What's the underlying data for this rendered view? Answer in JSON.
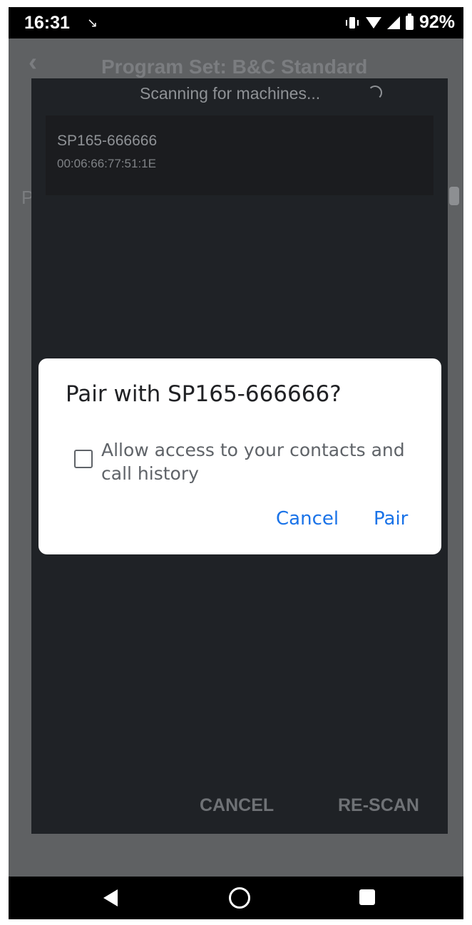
{
  "status_bar": {
    "time": "16:31",
    "notification_icon": "missed-call-icon",
    "battery_percent": "92%",
    "icons": [
      "vibrate-icon",
      "wifi-icon",
      "signal-icon",
      "battery-icon"
    ]
  },
  "app_header": {
    "back_icon": "chevron-left-icon",
    "title": "Program Set: B&C Standard"
  },
  "background": {
    "partial_letter": "P"
  },
  "scan_dialog": {
    "title": "Scanning for machines...",
    "devices": [
      {
        "name": "SP165-666666",
        "mac": "00:06:66:77:51:1E"
      }
    ],
    "cancel_label": "CANCEL",
    "rescan_label": "RE-SCAN"
  },
  "pair_dialog": {
    "title": "Pair with SP165-666666?",
    "checkbox_label": "Allow access to your contacts and call history",
    "checkbox_checked": false,
    "cancel_label": "Cancel",
    "pair_label": "Pair",
    "accent_color": "#1a73e8"
  },
  "nav_bar": {
    "icons": [
      "back-icon",
      "home-icon",
      "recents-icon"
    ]
  }
}
